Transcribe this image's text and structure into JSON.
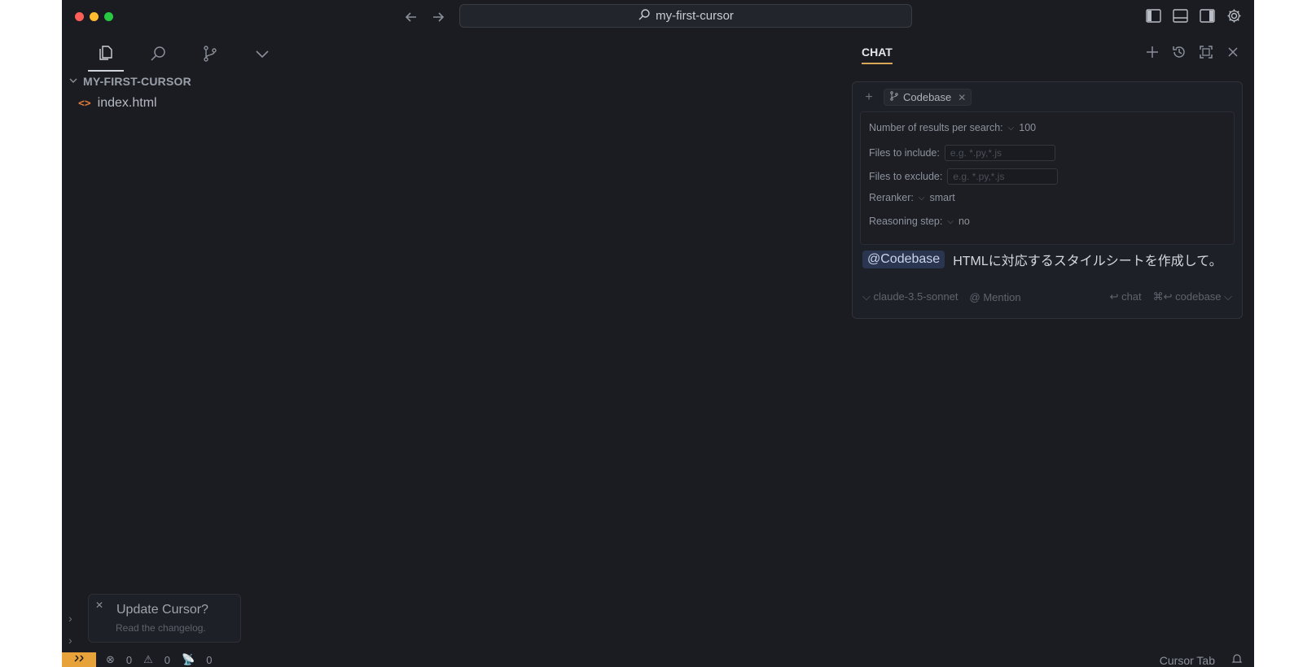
{
  "window": {
    "title": "my-first-cursor"
  },
  "sidebar": {
    "folder_name": "MY-FIRST-CURSOR",
    "files": [
      {
        "name": "index.html",
        "icon": "html-file-icon"
      }
    ],
    "collapsed_sections": [
      "",
      ""
    ]
  },
  "chat": {
    "tab_label": "CHAT",
    "context_chip": "Codebase",
    "options": {
      "results_label": "Number of results per search:",
      "results_value": "100",
      "include_label": "Files to include:",
      "include_placeholder": "e.g. *.py,*.js",
      "exclude_label": "Files to exclude:",
      "exclude_placeholder": "e.g. *.py,*.js",
      "reranker_label": "Reranker:",
      "reranker_value": "smart",
      "reasoning_label": "Reasoning step:",
      "reasoning_value": "no"
    },
    "prompt_mention": "@Codebase",
    "prompt_text": "HTMLに対応するスタイルシートを作成して。",
    "footer": {
      "model": "claude-3.5-sonnet",
      "mention": "@ Mention",
      "chat_shortcut": "↩ chat",
      "codebase_shortcut": "⌘↩ codebase"
    }
  },
  "notification": {
    "title": "Update Cursor?",
    "subtitle": "Read the changelog."
  },
  "statusbar": {
    "errors": "0",
    "warnings": "0",
    "ports": "0",
    "cursor_tab": "Cursor Tab"
  },
  "colors": {
    "background": "#1b1c22",
    "accent": "#e8a23a",
    "mention_bg": "#2a3550"
  }
}
